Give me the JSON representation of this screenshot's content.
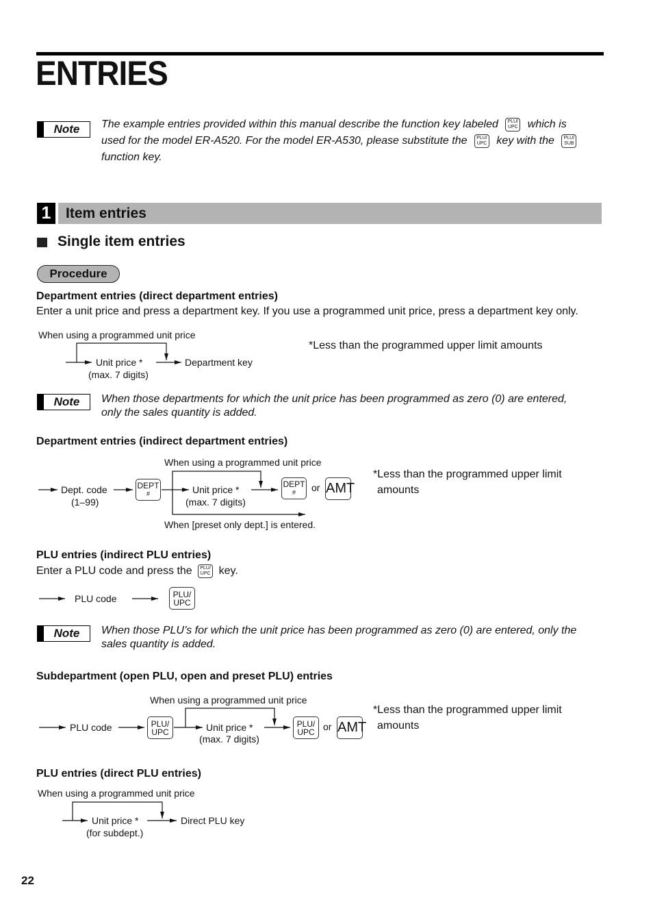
{
  "page": {
    "title": "ENTRIES",
    "page_number": "22"
  },
  "top_note": {
    "badge": "Note",
    "line1_a": "The example entries provided within this manual describe the function key labeled",
    "line1_b": "which is",
    "line2_a": "used for the model ER-A520. For the model ER-A530, please substitute the",
    "line2_b": "key with the",
    "line3": "function key.",
    "key_plu_upc": [
      "PLU/",
      "UPC"
    ],
    "key_plu_sub": [
      "PLU/",
      "SUB"
    ]
  },
  "section": {
    "number": "1",
    "title": "Item entries",
    "subtitle": "Single item entries",
    "procedure_label": "Procedure"
  },
  "dept_direct": {
    "heading": "Department entries (direct department entries)",
    "description": "Enter a unit price and press a department key.  If you use a programmed unit price, press a department key only.",
    "diagram": {
      "bypass_label": "When using a programmed unit price",
      "step1": "Unit price *",
      "step1_sub": "(max. 7 digits)",
      "step2": "Department key",
      "footnote": "*Less than the programmed upper limit amounts"
    },
    "note": {
      "badge": "Note",
      "line1": "When those departments for which the unit price has been programmed as zero (0) are entered,",
      "line2": "only the sales quantity is added."
    }
  },
  "dept_indirect": {
    "heading": "Department entries (indirect department entries)",
    "diagram": {
      "bypass_label": "When using a programmed unit price",
      "step1": "Dept. code",
      "step1_sub": "(1–99)",
      "key_dept": [
        "DEPT",
        "#"
      ],
      "step2": "Unit price *",
      "step2_sub": "(max. 7 digits)",
      "or": "or",
      "key_amt": "AMT",
      "preset_label": "When [preset only dept.] is entered.",
      "footnote_line1": "*Less than the programmed upper limit",
      "footnote_line2": "amounts"
    }
  },
  "plu_indirect": {
    "heading": "PLU entries (indirect PLU entries)",
    "description_a": "Enter a PLU code and press the",
    "description_b": "key.",
    "diagram": {
      "step1": "PLU code",
      "key_plu": [
        "PLU/",
        "UPC"
      ]
    },
    "note": {
      "badge": "Note",
      "line1": "When those PLU’s for which the unit price has been programmed as zero (0) are entered, only the",
      "line2": "sales quantity is added."
    }
  },
  "subdept": {
    "heading": "Subdepartment (open PLU, open and preset PLU) entries",
    "diagram": {
      "bypass_label": "When using a programmed unit price",
      "step1": "PLU code",
      "key_plu": [
        "PLU/",
        "UPC"
      ],
      "step2": "Unit price *",
      "step2_sub": "(max. 7 digits)",
      "or": "or",
      "key_amt": "AMT",
      "footnote_line1": "*Less than the programmed upper limit",
      "footnote_line2": "amounts"
    }
  },
  "plu_direct": {
    "heading": "PLU entries (direct PLU entries)",
    "diagram": {
      "bypass_label": "When using a programmed unit price",
      "step1": "Unit price *",
      "step1_sub": "(for subdept.)",
      "step2": "Direct PLU key"
    }
  }
}
